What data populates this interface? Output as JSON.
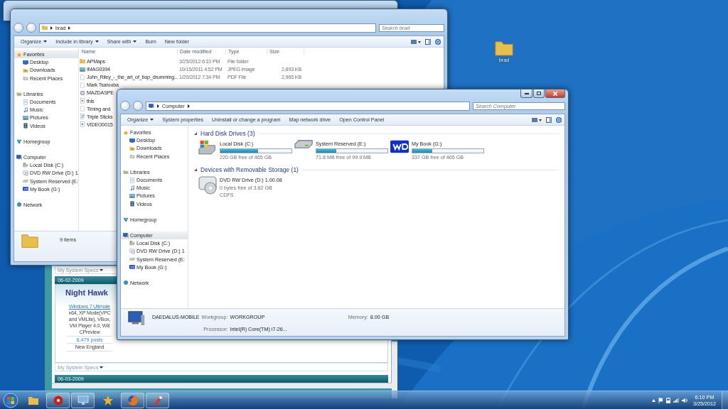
{
  "desktop_icons": [
    {
      "label": "brad",
      "kind": "folder"
    }
  ],
  "browser": {
    "specs_top": "My System Specs",
    "post_date": "06-02-2009",
    "author": "Night Hawk",
    "os_link": "Windows 7 Ultimate",
    "os_detail": "x64, XP Mode(VPC and VMLite), VBox, VM Player 4.0, W8 CPreview",
    "post_count": "6,479 posts",
    "location": "New England",
    "specs_bottom": "My System Specs",
    "next_post_date": "06-03-2009"
  },
  "brad_window": {
    "address": "brad",
    "search_placeholder": "Search brad",
    "toolbar": [
      {
        "label": "Organize",
        "dropdown": true
      },
      {
        "label": "Include in library",
        "dropdown": true
      },
      {
        "label": "Share with",
        "dropdown": true
      },
      {
        "label": "Burn",
        "dropdown": false
      },
      {
        "label": "New folder",
        "dropdown": false
      }
    ],
    "sidebar": [
      {
        "label": "Favorites",
        "kind": "star",
        "selected": true,
        "children": [
          {
            "label": "Desktop",
            "kind": "desktop",
            "selected": false
          },
          {
            "label": "Downloads",
            "kind": "downloads",
            "selected": false
          },
          {
            "label": "Recent Places",
            "kind": "recent",
            "selected": false
          }
        ]
      },
      {
        "label": "Libraries",
        "kind": "library",
        "selected": false,
        "children": [
          {
            "label": "Documents",
            "kind": "documents",
            "selected": false
          },
          {
            "label": "Music",
            "kind": "music",
            "selected": false
          },
          {
            "label": "Pictures",
            "kind": "pictures",
            "selected": false
          },
          {
            "label": "Videos",
            "kind": "videos",
            "selected": false
          }
        ]
      },
      {
        "label": "Homegroup",
        "kind": "homegroup",
        "selected": false
      },
      {
        "label": "Computer",
        "kind": "computer",
        "selected": false,
        "children": [
          {
            "label": "Local Disk (C:)",
            "kind": "disk-windows",
            "selected": false
          },
          {
            "label": "DVD RW Drive (D:) 1",
            "kind": "dvd",
            "selected": false
          },
          {
            "label": "System Reserved (E:",
            "kind": "disk",
            "selected": false
          },
          {
            "label": "My Book (G:)",
            "kind": "wd",
            "selected": false
          }
        ]
      },
      {
        "label": "Network",
        "kind": "network",
        "selected": false
      }
    ],
    "columns": [
      "Name",
      "Date modified",
      "Type",
      "Size"
    ],
    "files": [
      {
        "name": "APMaps",
        "date": "3/25/2012 6:10 PM",
        "type": "File folder",
        "kind": "folder"
      },
      {
        "name": "IMAG0394",
        "date": "10/15/2011 4:52 PM",
        "type": "JPEG image",
        "size": "2,893 KB"
      },
      {
        "name": "John_Riley_-_the_art_of_bop_drumming...",
        "date": "1/20/2012 7:34 PM",
        "type": "PDF File",
        "size": "2,965 KB",
        "kind": "pdf"
      },
      {
        "name": "Mark Tsarouba",
        "kind": "pdf"
      },
      {
        "name": "MAZDASPE",
        "kind": "app"
      },
      {
        "name": "this",
        "kind": "video"
      },
      {
        "name": "Timing and",
        "kind": "pdf"
      },
      {
        "name": "Triple Sticks",
        "kind": "audio"
      },
      {
        "name": "VIDEO0015",
        "kind": "video"
      }
    ],
    "status": "9 items"
  },
  "computer_window": {
    "address": "Computer",
    "search_placeholder": "Search Computer",
    "toolbar": [
      {
        "label": "Organize",
        "dropdown": true
      },
      {
        "label": "System properties",
        "dropdown": false
      },
      {
        "label": "Uninstall or change a program",
        "dropdown": false
      },
      {
        "label": "Map network drive",
        "dropdown": false
      },
      {
        "label": "Open Control Panel",
        "dropdown": false
      }
    ],
    "sidebar": [
      {
        "label": "Favorites",
        "kind": "star",
        "selected": false,
        "children": [
          {
            "label": "Desktop",
            "kind": "desktop",
            "selected": false
          },
          {
            "label": "Downloads",
            "kind": "downloads",
            "selected": false
          },
          {
            "label": "Recent Places",
            "kind": "recent",
            "selected": false
          }
        ]
      },
      {
        "label": "Libraries",
        "kind": "library",
        "selected": false,
        "children": [
          {
            "label": "Documents",
            "kind": "documents",
            "selected": false
          },
          {
            "label": "Music",
            "kind": "music",
            "selected": false
          },
          {
            "label": "Pictures",
            "kind": "pictures",
            "selected": false
          },
          {
            "label": "Videos",
            "kind": "videos",
            "selected": false
          }
        ]
      },
      {
        "label": "Homegroup",
        "kind": "homegroup",
        "selected": false
      },
      {
        "label": "Computer",
        "kind": "computer",
        "selected": true,
        "children": [
          {
            "label": "Local Disk (C:)",
            "kind": "disk-windows",
            "selected": false
          },
          {
            "label": "DVD RW Drive (D:) 1",
            "kind": "dvd",
            "selected": false
          },
          {
            "label": "System Reserved (E:",
            "kind": "disk",
            "selected": false
          },
          {
            "label": "My Book (G:)",
            "kind": "wd",
            "selected": false
          }
        ]
      },
      {
        "label": "Network",
        "kind": "network",
        "selected": false
      }
    ],
    "groups": [
      {
        "title": "Hard Disk Drives (3)",
        "expanded": true,
        "drives": [
          {
            "name": "Local Disk (C:)",
            "kind": "disk-windows",
            "level": 0.53,
            "free": "220 GB free of 465 GB"
          },
          {
            "name": "System Reserved (E:)",
            "kind": "disk",
            "level": 0.28,
            "free": "71.8 MB free of 99.9 MB"
          },
          {
            "name": "My Book (G:)",
            "kind": "wd",
            "level": 0.28,
            "free": "337 GB free of 465 GB"
          }
        ]
      },
      {
        "title": "Devices with Removable Storage (1)",
        "expanded": true,
        "drives": [
          {
            "name": "DVD RW Drive (D:) 1.00.08",
            "kind": "dvd",
            "free": "0 bytes free of 3.62 GB",
            "filesystem": "CDFS"
          }
        ]
      }
    ],
    "details": {
      "name": "DAEDALUS-MOBILE",
      "fields": [
        {
          "label": "Workgroup:",
          "value": "WORKGROUP"
        },
        {
          "label": "Memory:",
          "value": "8.00 GB"
        },
        {
          "label": "Processor:",
          "value": "Intel(R) Core(TM) i7-26..."
        }
      ]
    }
  },
  "taskbar": {
    "apps": [
      {
        "kind": "folder",
        "running": false
      },
      {
        "kind": "red-disc",
        "running": true
      },
      {
        "kind": "monitor",
        "running": true
      },
      {
        "kind": "yellow",
        "running": false
      },
      {
        "kind": "firefox",
        "running": true
      },
      {
        "kind": "paint",
        "running": true
      }
    ],
    "time": "6:10 PM",
    "date": "3/25/2012"
  }
}
